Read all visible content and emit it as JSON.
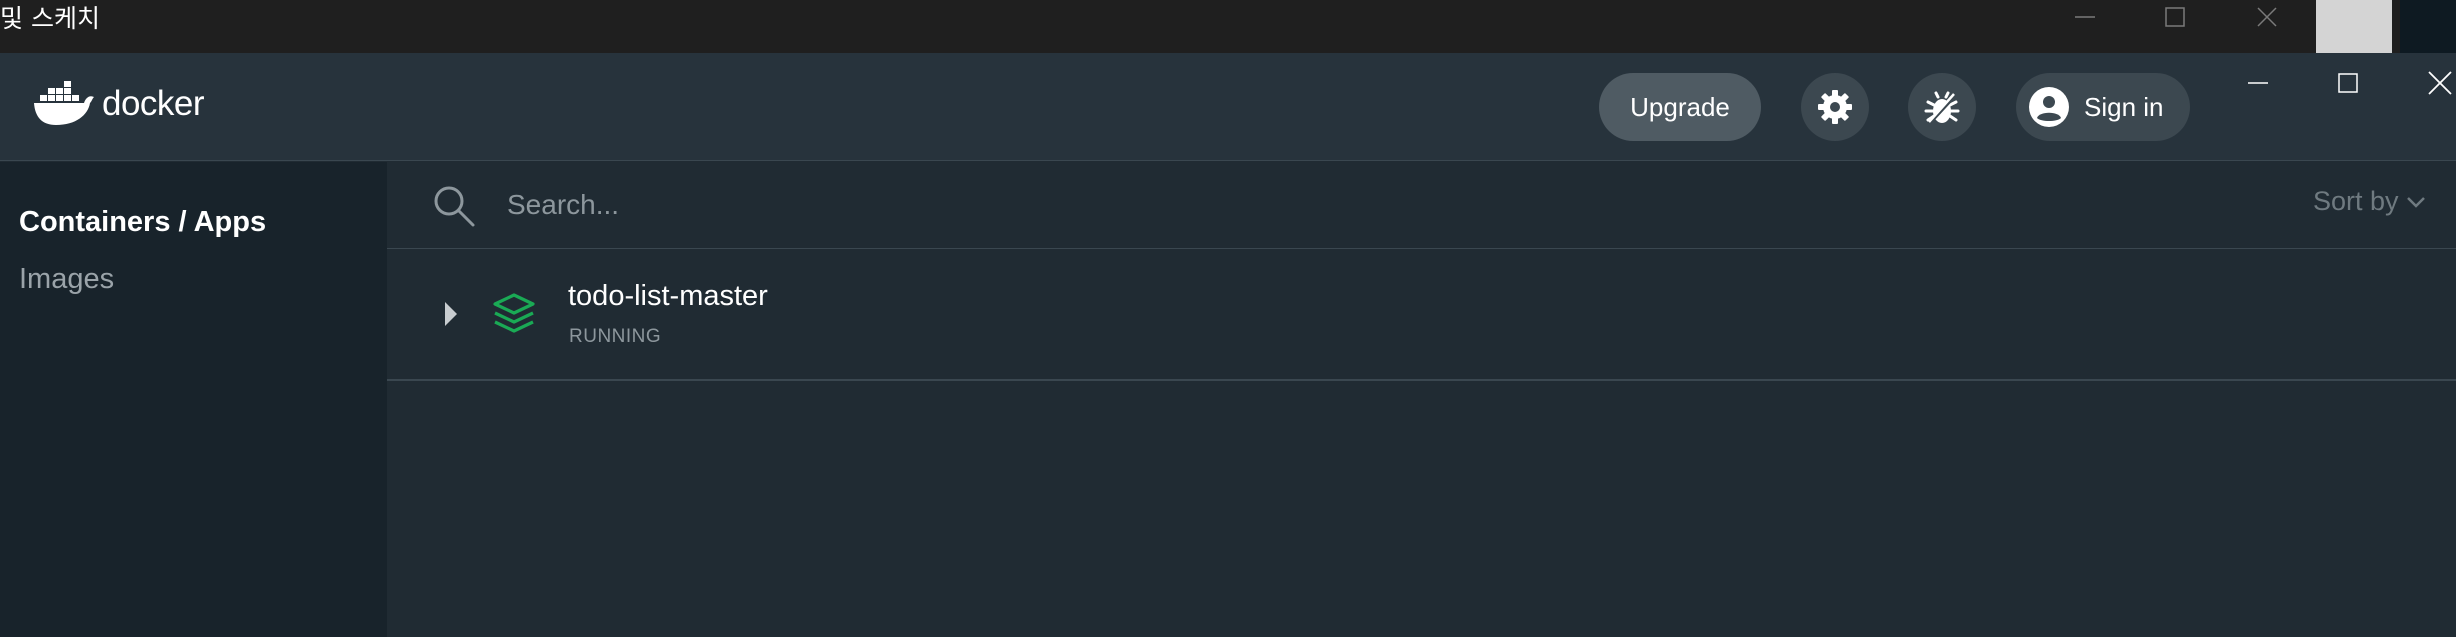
{
  "background_window": {
    "title": "및 스케치"
  },
  "app": {
    "logo_text": "docker",
    "header": {
      "upgrade_label": "Upgrade",
      "signin_label": "Sign in"
    },
    "sidebar": {
      "items": [
        {
          "label": "Containers / Apps",
          "active": true
        },
        {
          "label": "Images",
          "active": false
        }
      ]
    },
    "search": {
      "placeholder": "Search...",
      "sort_label": "Sort by"
    },
    "containers": [
      {
        "name": "todo-list-master",
        "status": "RUNNING",
        "icon": "stack-icon"
      }
    ]
  },
  "colors": {
    "accent_green": "#1aaa55",
    "header_bg": "#27333c",
    "sidebar_bg": "#18232b",
    "main_bg": "#202b33"
  }
}
